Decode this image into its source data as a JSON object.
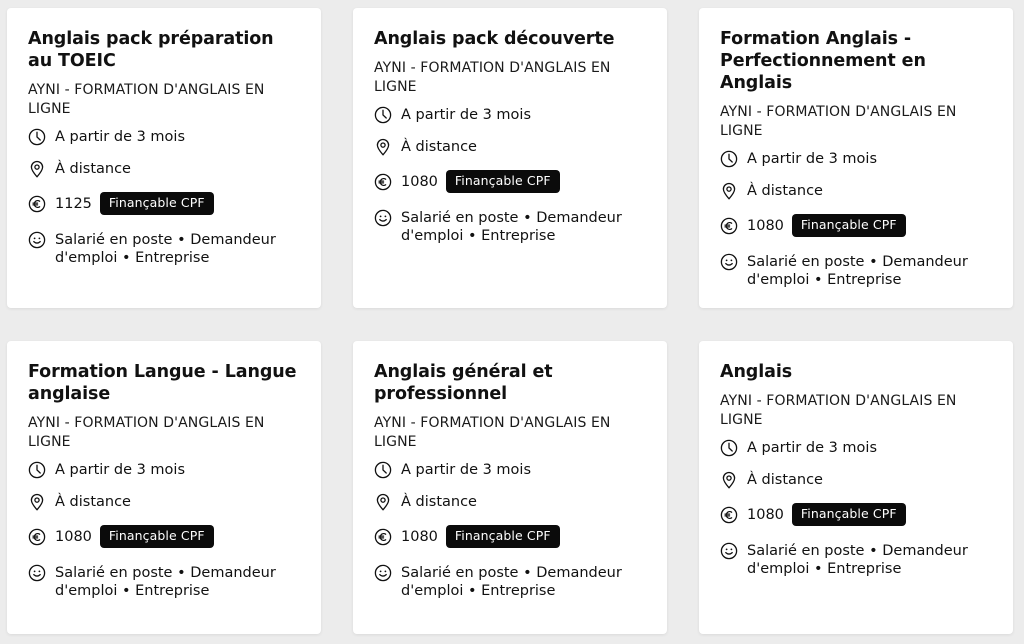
{
  "cards": [
    {
      "title": "Anglais pack préparation au TOEIC",
      "org": "AYNI - FORMATION D'ANGLAIS EN LIGNE",
      "duration": "A partir de 3 mois",
      "location": "À distance",
      "price": "1125",
      "badge": "Finançable CPF",
      "audience": "Salarié en poste • Demandeur d'emploi • Entreprise"
    },
    {
      "title": "Anglais pack découverte",
      "org": "AYNI - FORMATION D'ANGLAIS EN LIGNE",
      "duration": "A partir de 3 mois",
      "location": "À distance",
      "price": "1080",
      "badge": "Finançable CPF",
      "audience": "Salarié en poste • Demandeur d'emploi • Entreprise"
    },
    {
      "title": "Formation Anglais - Perfectionnement en Anglais",
      "org": "AYNI - FORMATION D'ANGLAIS EN LIGNE",
      "duration": "A partir de 3 mois",
      "location": "À distance",
      "price": "1080",
      "badge": "Finançable CPF",
      "audience": "Salarié en poste • Demandeur d'emploi • Entreprise"
    },
    {
      "title": "Formation Langue - Langue anglaise",
      "org": "AYNI - FORMATION D'ANGLAIS EN LIGNE",
      "duration": "A partir de 3 mois",
      "location": "À distance",
      "price": "1080",
      "badge": "Finançable CPF",
      "audience": "Salarié en poste • Demandeur d'emploi • Entreprise"
    },
    {
      "title": "Anglais général et professionnel",
      "org": "AYNI - FORMATION D'ANGLAIS EN LIGNE",
      "duration": "A partir de 3 mois",
      "location": "À distance",
      "price": "1080",
      "badge": "Finançable CPF",
      "audience": "Salarié en poste • Demandeur d'emploi • Entreprise"
    },
    {
      "title": "Anglais",
      "org": "AYNI - FORMATION D'ANGLAIS EN LIGNE",
      "duration": "A partir de 3 mois",
      "location": "À distance",
      "price": "1080",
      "badge": "Finançable CPF",
      "audience": "Salarié en poste • Demandeur d'emploi • Entreprise"
    }
  ],
  "icons": {
    "duration": "clock-icon",
    "location": "map-pin-icon",
    "price": "euro-icon",
    "audience": "smiley-icon"
  },
  "colors": {
    "background": "#ececec",
    "card": "#ffffff",
    "badge_bg": "#0b0b0b",
    "badge_text": "#ffffff"
  }
}
